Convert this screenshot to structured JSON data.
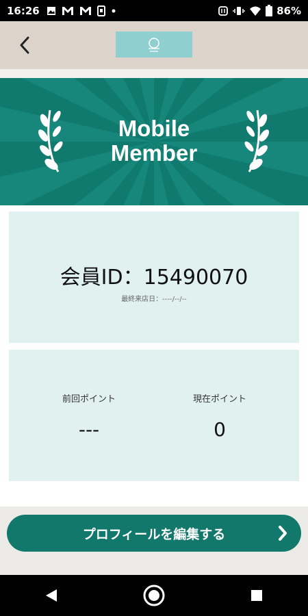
{
  "status_bar": {
    "time": "16:26",
    "battery": "86%",
    "left_icons": [
      "image-icon",
      "gmail-icon",
      "gmail-icon",
      "phone-icon",
      "dot-icon"
    ],
    "right_icons": [
      "nfc-icon",
      "vibrate-icon",
      "wifi-icon",
      "battery-icon"
    ]
  },
  "header": {
    "back_icon": "back-arrow-icon",
    "logo_color": "#8fcfcf"
  },
  "hero": {
    "title_line1": "Mobile",
    "title_line2": "Member",
    "bg_color": "#0f7a6d"
  },
  "member": {
    "id_text": "会員ID：15490070",
    "last_visit": "最終来店日：----/--/--"
  },
  "points": {
    "previous_label": "前回ポイント",
    "previous_value": "---",
    "current_label": "現在ポイント",
    "current_value": "0"
  },
  "actions": {
    "edit_profile_label": "プロフィールを編集する",
    "button_color": "#11786b"
  },
  "nav": {
    "buttons": [
      "back-triangle-icon",
      "home-circle-icon",
      "recents-square-icon"
    ]
  }
}
